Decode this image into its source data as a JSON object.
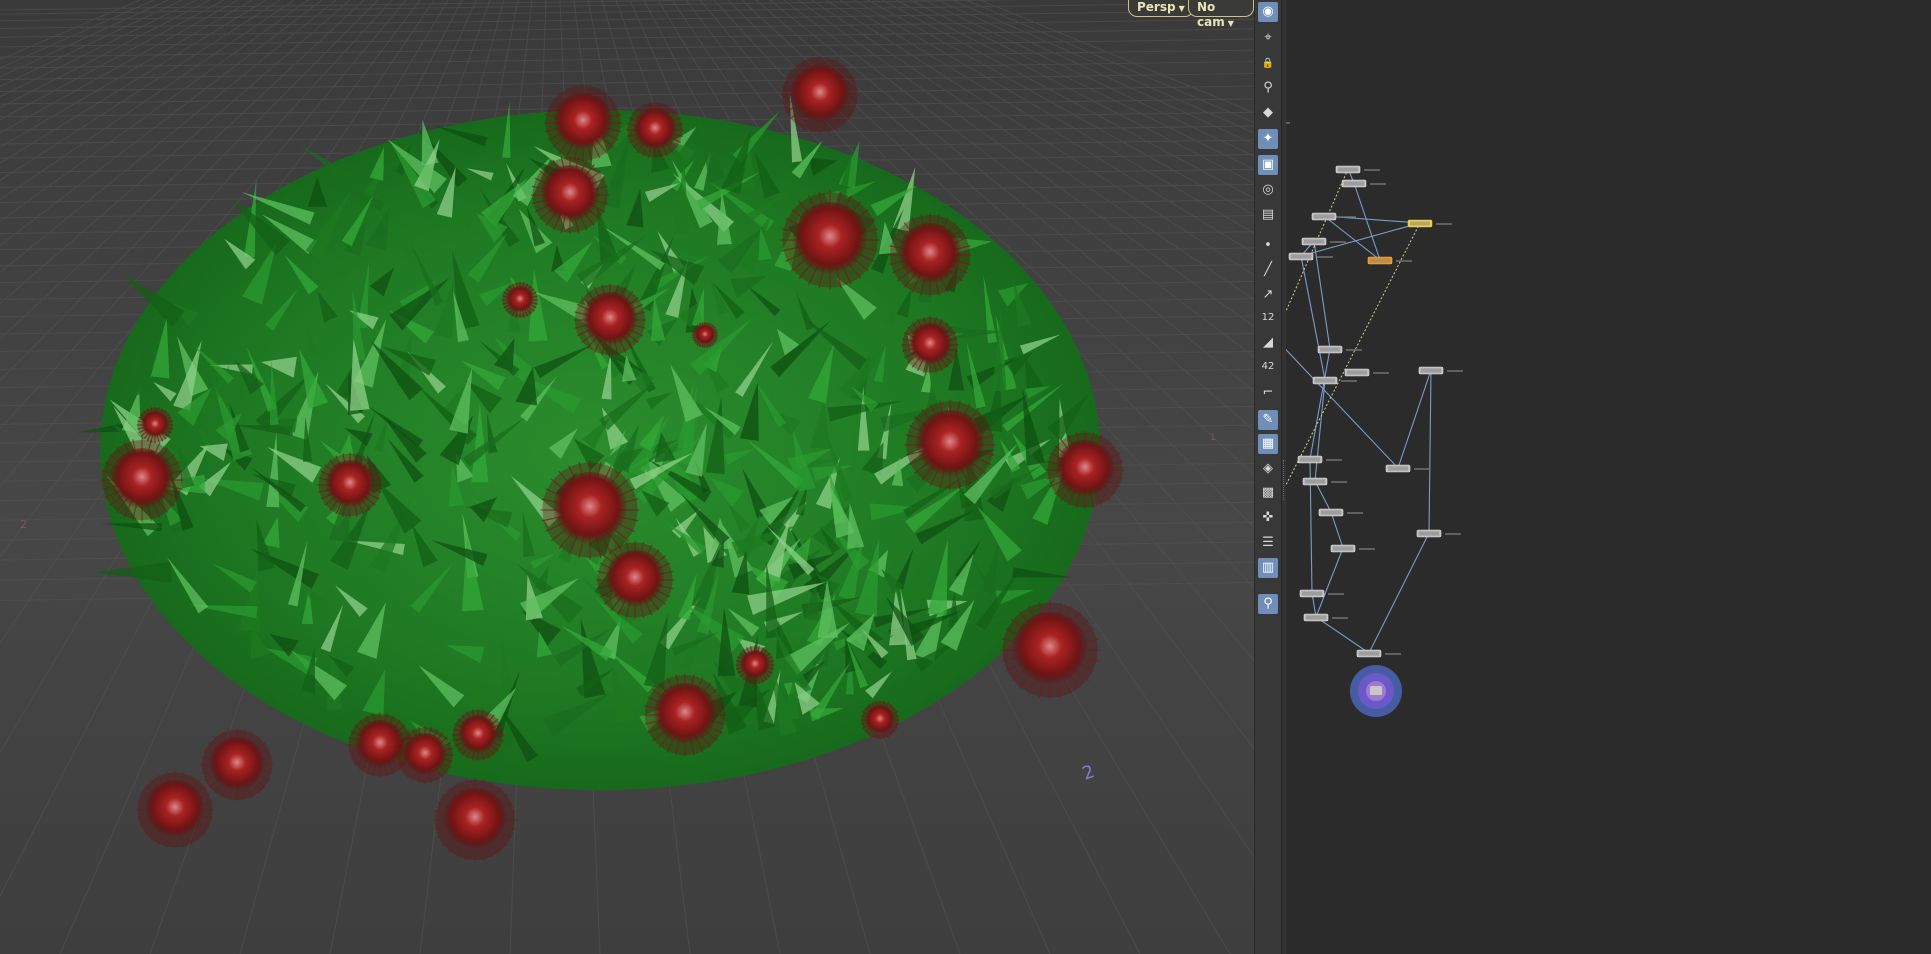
{
  "viewport": {
    "camera_menu": "Persp",
    "cam_menu": "No cam",
    "grid_labels": [
      "2",
      "2",
      "1"
    ],
    "colors": {
      "foliage": "#1e7a22",
      "berries": "#8b1a1a",
      "grid": "#5a5a5a"
    }
  },
  "toolbar": {
    "items": [
      {
        "name": "view-icon",
        "glyph": "◉",
        "active": true
      },
      {
        "name": "select-icon",
        "glyph": "⌖",
        "active": false
      },
      {
        "name": "lock-icon",
        "glyph": "🔒",
        "active": false
      },
      {
        "name": "pin-icon",
        "glyph": "⚲",
        "active": false
      },
      {
        "name": "light-icon",
        "glyph": "◆",
        "active": false
      },
      {
        "name": "bulb-icon",
        "glyph": "✦",
        "active": true
      },
      {
        "name": "shading-icon",
        "glyph": "▣",
        "active": true
      },
      {
        "name": "visibility-icon",
        "glyph": "◎",
        "active": false
      },
      {
        "name": "ghost-icon",
        "glyph": "▤",
        "active": false
      },
      {
        "name": "point-icon",
        "glyph": "•",
        "active": false
      },
      {
        "name": "normal-icon",
        "glyph": "╱",
        "active": false
      },
      {
        "name": "vector-icon",
        "glyph": "↗",
        "active": false
      },
      {
        "name": "number-icon",
        "glyph": "12",
        "active": false
      },
      {
        "name": "prim-icon",
        "glyph": "◢",
        "active": false
      },
      {
        "name": "prim-number-icon",
        "glyph": "42",
        "active": false
      },
      {
        "name": "bounds-icon",
        "glyph": "⌐",
        "active": false
      },
      {
        "name": "brush-icon",
        "glyph": "✎",
        "active": true
      },
      {
        "name": "checker-icon",
        "glyph": "▦",
        "active": true
      },
      {
        "name": "diamond-icon",
        "glyph": "◈",
        "active": false
      },
      {
        "name": "film-icon",
        "glyph": "▩",
        "active": false
      },
      {
        "name": "axis-icon",
        "glyph": "✜",
        "active": false
      },
      {
        "name": "display-icon",
        "glyph": "☰",
        "active": false
      },
      {
        "name": "camera-icon",
        "glyph": "▥",
        "active": true
      },
      {
        "name": "bulb-settings-icon",
        "glyph": "⚲",
        "active": true
      }
    ]
  },
  "network": {
    "accent_colors": {
      "selected": "#f0c020",
      "orange": "#e89020",
      "wire": "#7a9cc8",
      "output": "#6a5ac8"
    }
  }
}
